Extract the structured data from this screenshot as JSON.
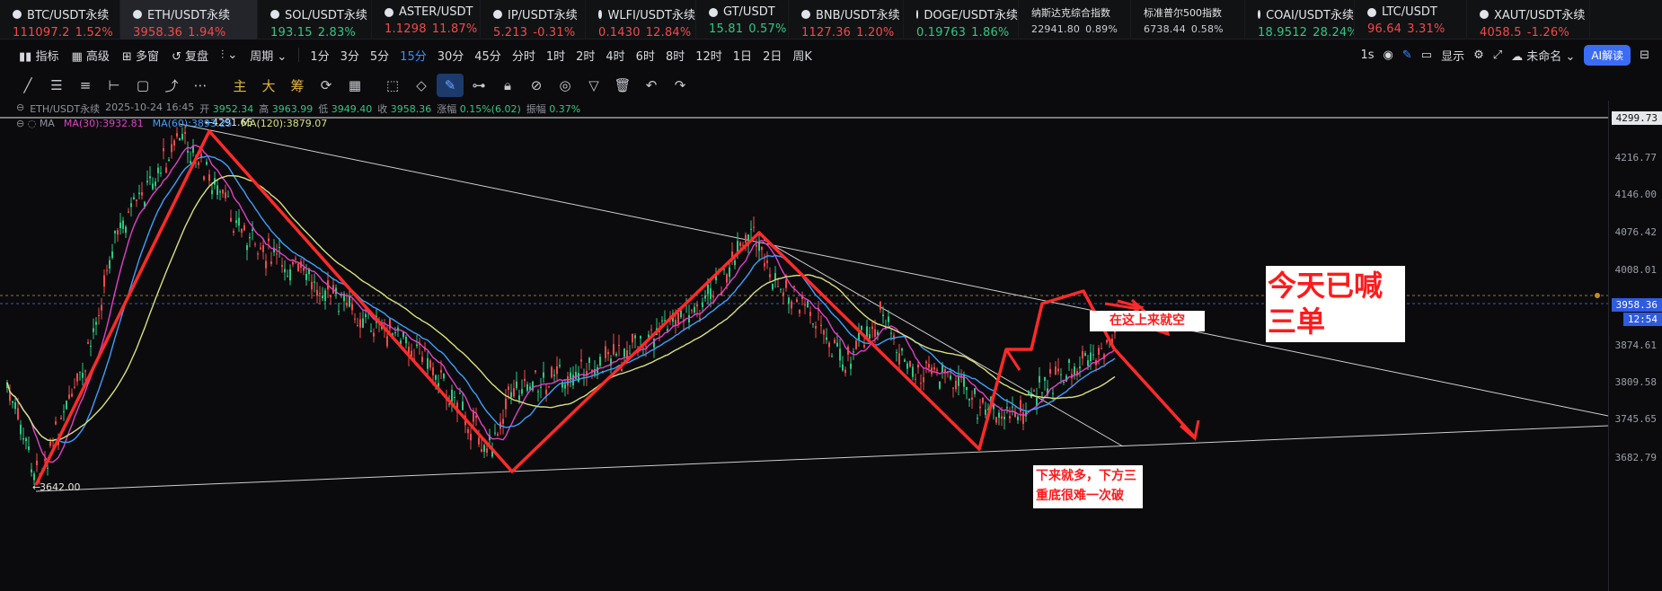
{
  "tickers": [
    {
      "name": "BTC/USDT永续",
      "price": "111097.2",
      "change": "1.52%",
      "trend": "dn"
    },
    {
      "name": "ETH/USDT永续",
      "price": "3958.36",
      "change": "1.94%",
      "trend": "dn"
    },
    {
      "name": "SOL/USDT永续",
      "price": "193.15",
      "change": "2.83%",
      "trend": "up"
    },
    {
      "name": "ASTER/USDT",
      "price": "1.1298",
      "change": "11.87%",
      "trend": "dn"
    },
    {
      "name": "IP/USDT永续",
      "price": "5.213",
      "change": "-0.31%",
      "trend": "dn"
    },
    {
      "name": "WLFI/USDT永续",
      "price": "0.1430",
      "change": "12.84%",
      "trend": "dn"
    },
    {
      "name": "GT/USDT",
      "price": "15.81",
      "change": "0.57%",
      "trend": "up"
    },
    {
      "name": "BNB/USDT永续",
      "price": "1127.36",
      "change": "1.20%",
      "trend": "dn"
    },
    {
      "name": "DOGE/USDT永续",
      "price": "0.19763",
      "change": "1.86%",
      "trend": "up"
    },
    {
      "name": "纳斯达克综合指数",
      "price": "22941.80",
      "change": "0.89%",
      "trend": "neu"
    },
    {
      "name": "标准普尔500指数",
      "price": "6738.44",
      "change": "0.58%",
      "trend": "neu"
    },
    {
      "name": "COAI/USDT永续",
      "price": "18.9512",
      "change": "28.24%",
      "trend": "up"
    },
    {
      "name": "LTC/USDT",
      "price": "96.64",
      "change": "3.31%",
      "trend": "dn"
    },
    {
      "name": "XAUT/USDT永续",
      "price": "4058.5",
      "change": "-1.26%",
      "trend": "dn"
    }
  ],
  "toolbar": {
    "indicators": "指标",
    "advanced": "高级",
    "multiwin": "多窗",
    "replay": "复盘",
    "period": "周期",
    "intervals": [
      "1分",
      "3分",
      "5分",
      "15分",
      "30分",
      "45分",
      "分时",
      "1时",
      "2时",
      "4时",
      "6时",
      "8时",
      "12时",
      "1日",
      "2日",
      "周K"
    ],
    "selected_interval": "15分",
    "sec": "1s",
    "display": "显示",
    "unnamed": "未命名",
    "ai": "AI解读"
  },
  "drawtools": {
    "main": "主",
    "big": "大",
    "chips": "筹"
  },
  "info": {
    "symbol": "ETH/USDT永续",
    "date": "2025-10-24 16:45",
    "open_label": "开",
    "open": "3952.34",
    "high_label": "高",
    "high": "3963.99",
    "low_label": "低",
    "low": "3949.40",
    "close_label": "收",
    "close": "3958.36",
    "chg_label": "涨幅",
    "chg": "0.15%(6.02)",
    "amp_label": "振幅",
    "amp": "0.37%",
    "ma_label": "MA",
    "ma30": "MA(30):3932.81",
    "ma60": "MA(60):3893.25",
    "ma120": "MA(120):3879.07"
  },
  "axis": {
    "ticks": [
      "4216.77",
      "4146.00",
      "4076.42",
      "4008.01",
      "3874.61",
      "3809.58",
      "3745.65",
      "3682.79"
    ],
    "top_box": "4299.73",
    "price_box": "3958.36",
    "countdown": "12:54"
  },
  "chart_labels": {
    "high": "4291.65",
    "low": "3642.00"
  },
  "notes": {
    "today": "今天已喊三单",
    "short_zone": "在这上来就空",
    "long_zone": "下来就多，下方三重底很难一次破"
  },
  "colors": {
    "ma30": "#e040c8",
    "ma60": "#3aa0ff",
    "ma120": "#d8e07a",
    "arrow": "#ff2a2a",
    "up": "#2ec785",
    "down": "#f04a4a"
  }
}
